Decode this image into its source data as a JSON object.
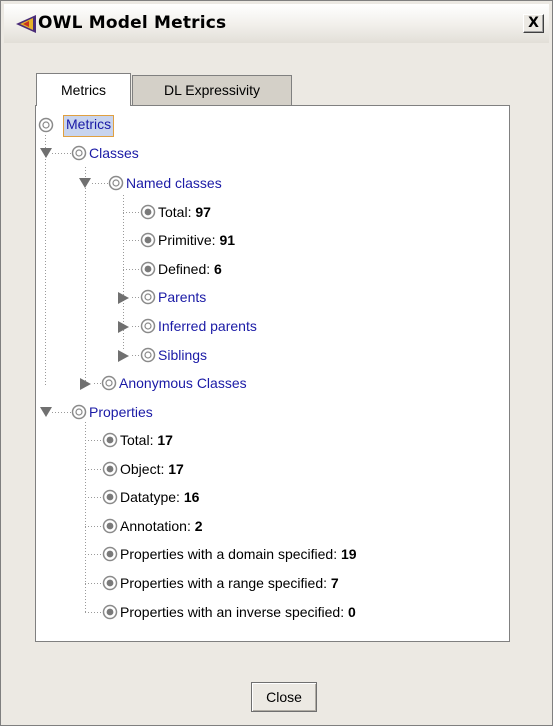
{
  "window": {
    "title": "OWL Model Metrics",
    "close_glyph": "X"
  },
  "tabs": [
    {
      "label": "Metrics",
      "selected": true
    },
    {
      "label": "DL Expressivity",
      "selected": false
    }
  ],
  "tree": {
    "root": "Metrics",
    "classes": {
      "label": "Classes",
      "named": {
        "label": "Named classes",
        "total": {
          "label": "Total:",
          "value": "97"
        },
        "primitive": {
          "label": "Primitive:",
          "value": "91"
        },
        "defined": {
          "label": "Defined:",
          "value": "6"
        },
        "parents": "Parents",
        "inferred_parents": "Inferred parents",
        "siblings": "Siblings"
      },
      "anonymous": "Anonymous Classes"
    },
    "properties": {
      "label": "Properties",
      "total": {
        "label": "Total:",
        "value": "17"
      },
      "object": {
        "label": "Object:",
        "value": "17"
      },
      "datatype": {
        "label": "Datatype:",
        "value": "16"
      },
      "annotation": {
        "label": "Annotation:",
        "value": "2"
      },
      "domain": {
        "label": "Properties with a domain specified:",
        "value": "19"
      },
      "range": {
        "label": "Properties with a range specified:",
        "value": "7"
      },
      "inverse": {
        "label": "Properties with an inverse specified:",
        "value": "0"
      }
    }
  },
  "buttons": {
    "close": "Close"
  },
  "icons": {
    "app": "owl-logo-icon",
    "node": "circle-node-icon",
    "expanded": "triangle-down-icon",
    "collapsed": "triangle-right-icon"
  }
}
